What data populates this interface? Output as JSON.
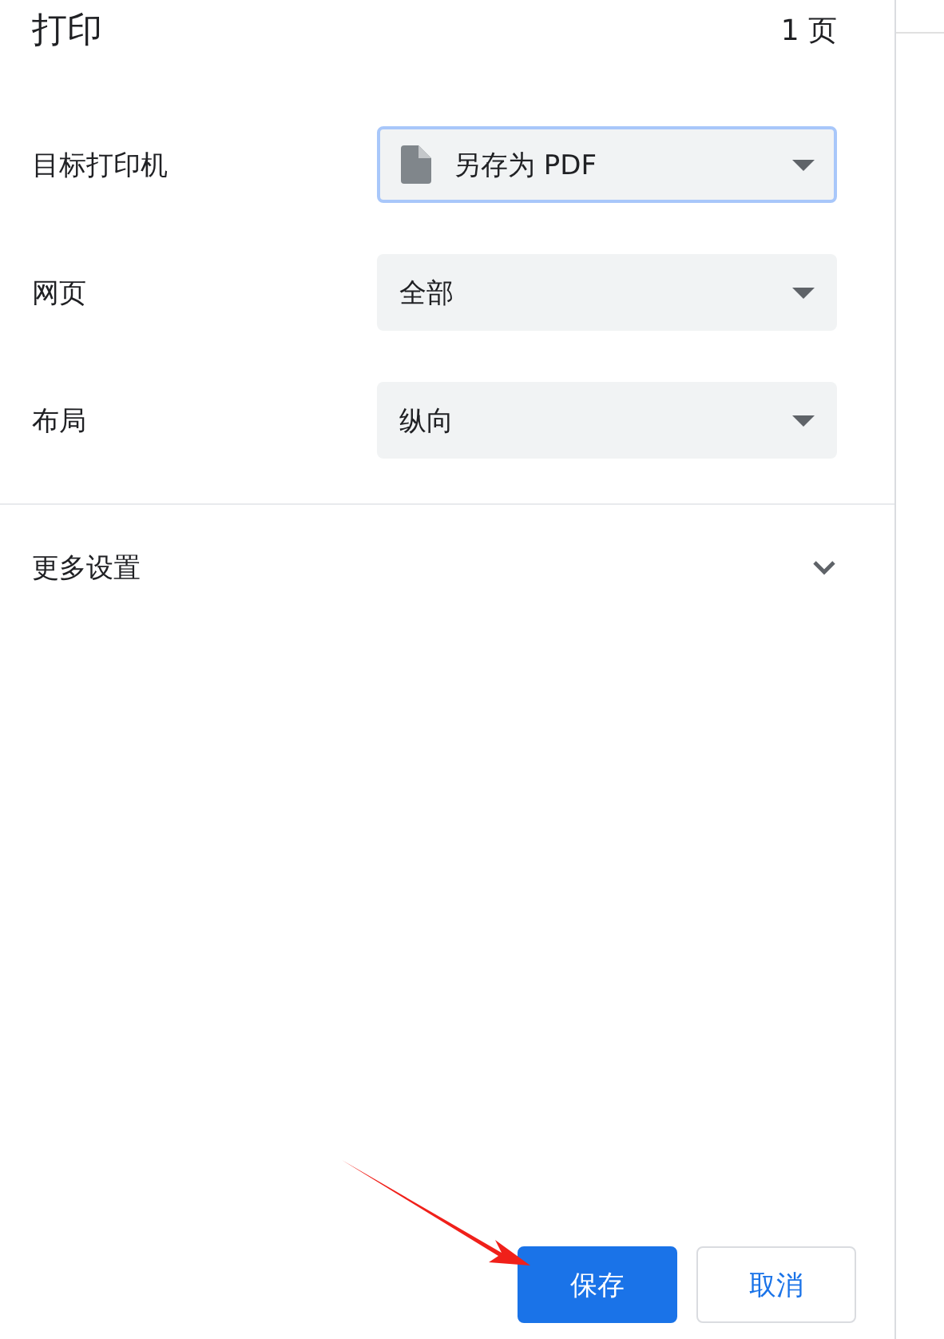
{
  "header": {
    "title": "打印",
    "page_count": "1 页"
  },
  "settings": [
    {
      "label": "目标打印机",
      "value": "另存为 PDF",
      "kind": "icon",
      "focused": true
    },
    {
      "label": "网页",
      "value": "全部",
      "kind": "plain",
      "focused": false
    },
    {
      "label": "布局",
      "value": "纵向",
      "kind": "plain",
      "focused": false
    }
  ],
  "more_settings": {
    "label": "更多设置",
    "expanded": false
  },
  "buttons": [
    {
      "label": "保存",
      "kind": "primary"
    },
    {
      "label": "取消",
      "kind": "secondary"
    }
  ],
  "annotation": {
    "kind": "arrow"
  }
}
